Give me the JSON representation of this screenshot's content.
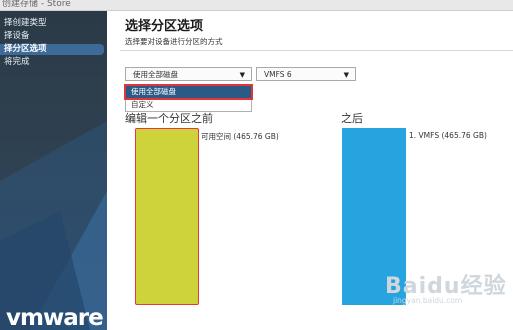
{
  "window": {
    "title": "创建存储 - Store"
  },
  "sidebar": {
    "items": [
      {
        "label": "择创建类型"
      },
      {
        "label": "择设备"
      },
      {
        "label": "择分区选项"
      },
      {
        "label": "将完成"
      }
    ],
    "active_index": 2
  },
  "brand": {
    "logo_text": "vmware"
  },
  "main": {
    "title": "选择分区选项",
    "subtitle": "选择要对设备进行分区的方式"
  },
  "partition_select": {
    "value": "使用全部磁盘",
    "options": [
      "使用全部磁盘",
      "自定义"
    ],
    "highlighted_option": "使用全部磁盘"
  },
  "fs_select": {
    "value": "VMFS 6"
  },
  "before": {
    "heading": "编辑一个分区之前",
    "partition_label": "可用空间  (465.76 GB)"
  },
  "after": {
    "heading": "之后",
    "partition_label": "1. VMFS  (465.76 GB)"
  },
  "watermark": {
    "text": "Baidu经验",
    "url": "jingyan.baidu.com"
  },
  "colors": {
    "sidebar_bg": "#2c3a47",
    "sidebar_active": "#3e6a9a",
    "highlight_border": "#e2353b",
    "free_space": "#cfd33b",
    "vmfs": "#26a4df"
  }
}
